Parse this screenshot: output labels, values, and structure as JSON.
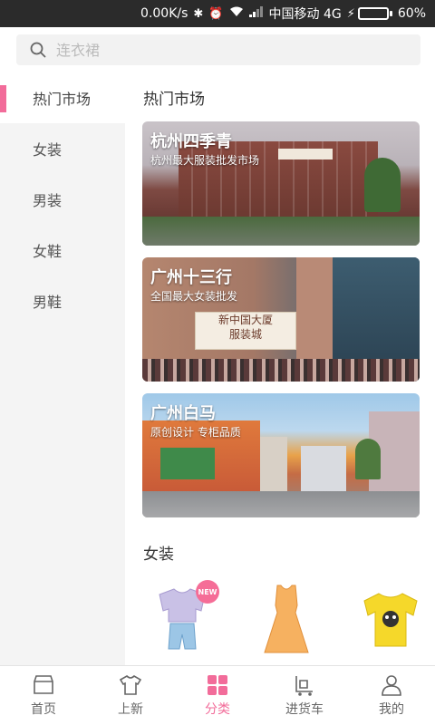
{
  "status_bar": {
    "speed": "0.00K/s",
    "carrier": "中国移动 4G",
    "battery_percent": "60%",
    "battery_level": 0.6
  },
  "search": {
    "placeholder": "连衣裙"
  },
  "sidebar": {
    "items": [
      {
        "label": "热门市场",
        "active": true
      },
      {
        "label": "女装",
        "active": false
      },
      {
        "label": "男装",
        "active": false
      },
      {
        "label": "女鞋",
        "active": false
      },
      {
        "label": "男鞋",
        "active": false
      }
    ]
  },
  "main": {
    "hot_section_title": "热门市场",
    "markets": [
      {
        "name": "杭州四季青",
        "desc": "杭州最大服装批发市场"
      },
      {
        "name": "广州十三行",
        "desc": "全国最大女装批发",
        "sign_line1": "新中国大厦",
        "sign_line2": "服装城"
      },
      {
        "name": "广州白马",
        "desc": "原创设计 专柜品质"
      }
    ],
    "women_section_title": "女装",
    "new_badge": "NEW"
  },
  "tabbar": {
    "items": [
      {
        "label": "首页",
        "icon": "shop-icon",
        "active": false
      },
      {
        "label": "上新",
        "icon": "shirt-icon",
        "active": false
      },
      {
        "label": "分类",
        "icon": "grid-icon",
        "active": true
      },
      {
        "label": "进货车",
        "icon": "cart-icon",
        "active": false
      },
      {
        "label": "我的",
        "icon": "user-icon",
        "active": false
      }
    ]
  },
  "colors": {
    "accent": "#f26c9a",
    "status_bar_bg": "#2b2b2b",
    "sidebar_bg": "#f4f4f4"
  }
}
